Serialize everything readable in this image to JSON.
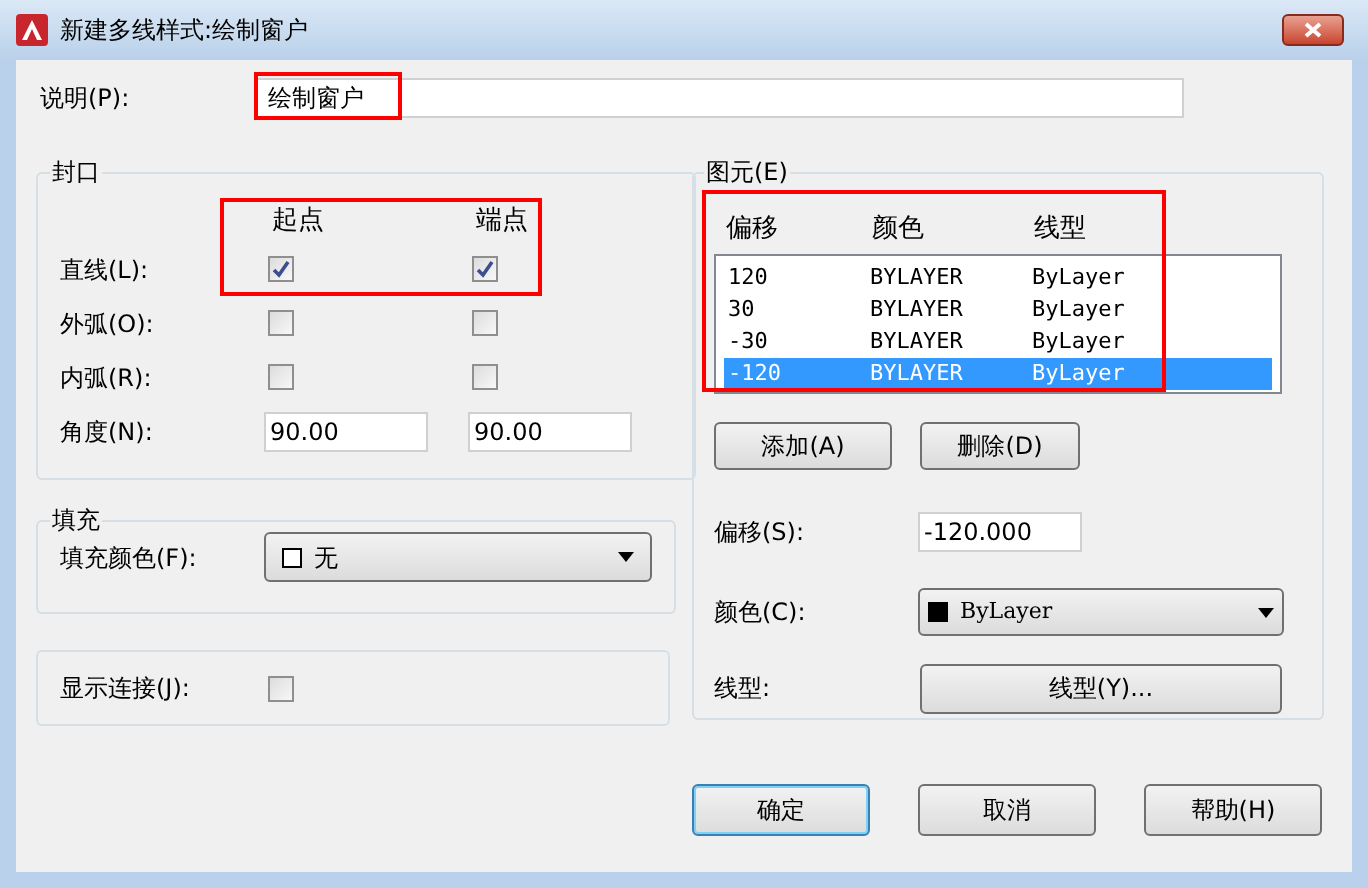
{
  "window": {
    "title": "新建多线样式:绘制窗户"
  },
  "description": {
    "label": "说明(P):",
    "value": "绘制窗户"
  },
  "caps": {
    "title": "封口",
    "columns": [
      "起点",
      "端点"
    ],
    "rows": [
      {
        "kind": "checkbox",
        "label": "直线(L):",
        "start_checked": true,
        "end_checked": true
      },
      {
        "kind": "checkbox",
        "label": "外弧(O):",
        "start_checked": false,
        "end_checked": false
      },
      {
        "kind": "checkbox",
        "label": "内弧(R):",
        "start_checked": false,
        "end_checked": false
      },
      {
        "kind": "field",
        "label": "角度(N):",
        "start_value": "90.00",
        "end_value": "90.00"
      }
    ]
  },
  "fill": {
    "title": "填充",
    "label": "填充颜色(F):",
    "value": "无"
  },
  "joints": {
    "label": "显示连接(J):",
    "checked": false
  },
  "elements": {
    "title": "图元(E)",
    "columns": [
      "偏移",
      "颜色",
      "线型"
    ],
    "rows": [
      {
        "cells": [
          "120",
          "BYLAYER",
          "ByLayer"
        ],
        "selected": false
      },
      {
        "cells": [
          "30",
          "BYLAYER",
          "ByLayer"
        ],
        "selected": false
      },
      {
        "cells": [
          "-30",
          "BYLAYER",
          "ByLayer"
        ],
        "selected": false
      },
      {
        "cells": [
          "-120",
          "BYLAYER",
          "ByLayer"
        ],
        "selected": true
      }
    ],
    "buttons": [
      "添加(A)",
      "删除(D)"
    ],
    "offset": {
      "label": "偏移(S):",
      "value": "-120.000"
    },
    "color": {
      "label": "颜色(C):",
      "value": "ByLayer"
    },
    "linetype": {
      "label": "线型:",
      "button": "线型(Y)..."
    }
  },
  "buttons": [
    {
      "label": "确定",
      "default": true
    },
    {
      "label": "取消",
      "default": false
    },
    {
      "label": "帮助(H)",
      "default": false
    }
  ]
}
